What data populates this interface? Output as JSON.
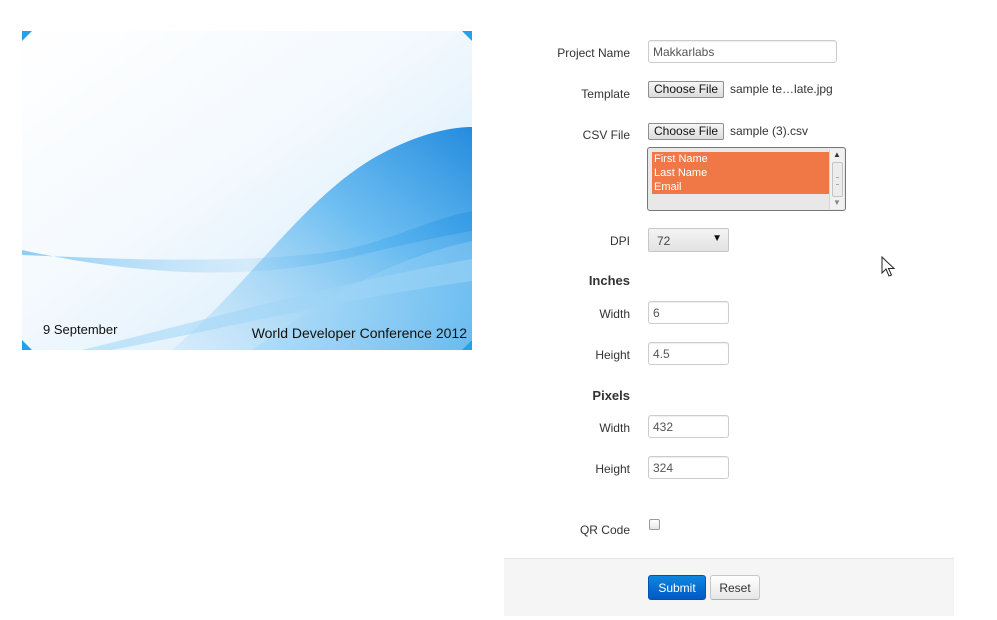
{
  "preview": {
    "date_text": "9 September",
    "conference_text": "World Developer Conference 2012"
  },
  "form": {
    "project_name": {
      "label": "Project Name",
      "value": "Makkarlabs"
    },
    "template": {
      "label": "Template",
      "button_label": "Choose File",
      "file_name": "sample te…late.jpg"
    },
    "csv_file": {
      "label": "CSV File",
      "button_label": "Choose File",
      "file_name": "sample (3).csv",
      "columns": [
        "First Name",
        "Last Name",
        "Email"
      ]
    },
    "dpi": {
      "label": "DPI",
      "selected": "72"
    },
    "inches": {
      "heading": "Inches",
      "width_label": "Width",
      "width_value": "6",
      "height_label": "Height",
      "height_value": "4.5"
    },
    "pixels": {
      "heading": "Pixels",
      "width_label": "Width",
      "width_value": "432",
      "height_label": "Height",
      "height_value": "324"
    },
    "qr_code": {
      "label": "QR Code",
      "checked": false
    }
  },
  "actions": {
    "submit_label": "Submit",
    "reset_label": "Reset"
  },
  "colors": {
    "selection_highlight": "#f07746",
    "primary_button": "#0a6fd6",
    "template_blue": "#3aa3e8"
  }
}
